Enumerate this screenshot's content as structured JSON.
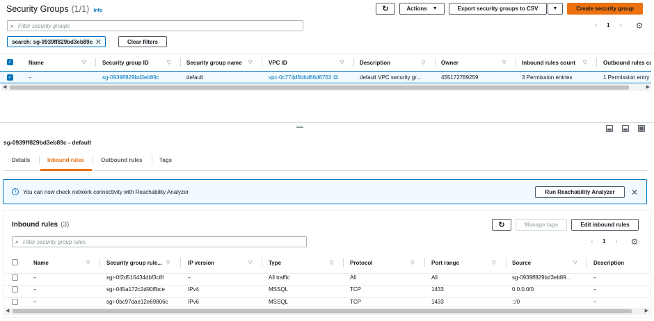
{
  "top": {
    "title": "Security Groups",
    "count": "(1/1)",
    "info": "Info",
    "refresh_icon": "refresh-icon",
    "actions_label": "Actions",
    "export_label": "Export security groups to CSV",
    "create_label": "Create security group",
    "search_placeholder": "Filter security groups",
    "filter_chip": "search: sg-0939ff829bd3eb89c",
    "clear_filters": "Clear filters",
    "page_number": "1",
    "columns": [
      "Name",
      "Security group ID",
      "Security group name",
      "VPC ID",
      "Description",
      "Owner",
      "Inbound rules count",
      "Outbound rules co"
    ],
    "row": {
      "name": "–",
      "sg_id": "sg-0939ff829bd3eb89c",
      "sg_name": "default",
      "vpc_id": "vpc-0c774d5bbd66d6763",
      "description": "default VPC security gr...",
      "owner": "455172789259",
      "inbound_count": "3 Permission entries",
      "outbound_count": "1 Permission entry"
    }
  },
  "detail": {
    "title": "sg-0939ff829bd3eb89c - default",
    "tabs": [
      "Details",
      "Inbound rules",
      "Outbound rules",
      "Tags"
    ],
    "active_tab": "Inbound rules",
    "banner_text": "You can now check network connectivity with Reachability Analyzer",
    "banner_button": "Run Reachability Analyzer",
    "rules_title": "Inbound rules",
    "rules_count": "(3)",
    "manage_tags": "Manage tags",
    "edit_inbound": "Edit inbound rules",
    "rules_search_placeholder": "Filter security group rules",
    "page_number": "1",
    "columns": [
      "Name",
      "Security group rule...",
      "IP version",
      "Type",
      "Protocol",
      "Port range",
      "Source",
      "Description"
    ],
    "rows": [
      {
        "name": "–",
        "rule_id": "sgr-0f2d516434dbf3c8f",
        "ip_version": "–",
        "type": "All traffic",
        "protocol": "All",
        "port_range": "All",
        "source": "sg-0939ff829bd3eb89...",
        "description": "–"
      },
      {
        "name": "–",
        "rule_id": "sgr-045a172c2d90ffbce",
        "ip_version": "IPv4",
        "type": "MSSQL",
        "protocol": "TCP",
        "port_range": "1433",
        "source": "0.0.0.0/0",
        "description": "–"
      },
      {
        "name": "–",
        "rule_id": "sgr-0bc97dae12e69806c",
        "ip_version": "IPv6",
        "type": "MSSQL",
        "protocol": "TCP",
        "port_range": "1433",
        "source": "::/0",
        "description": "–"
      }
    ]
  },
  "colors": {
    "accent": "#ec7211",
    "link": "#0073bb",
    "banner_bg": "#f1faff",
    "banner_border": "#0073bb",
    "selected_row": "#f1faff"
  }
}
